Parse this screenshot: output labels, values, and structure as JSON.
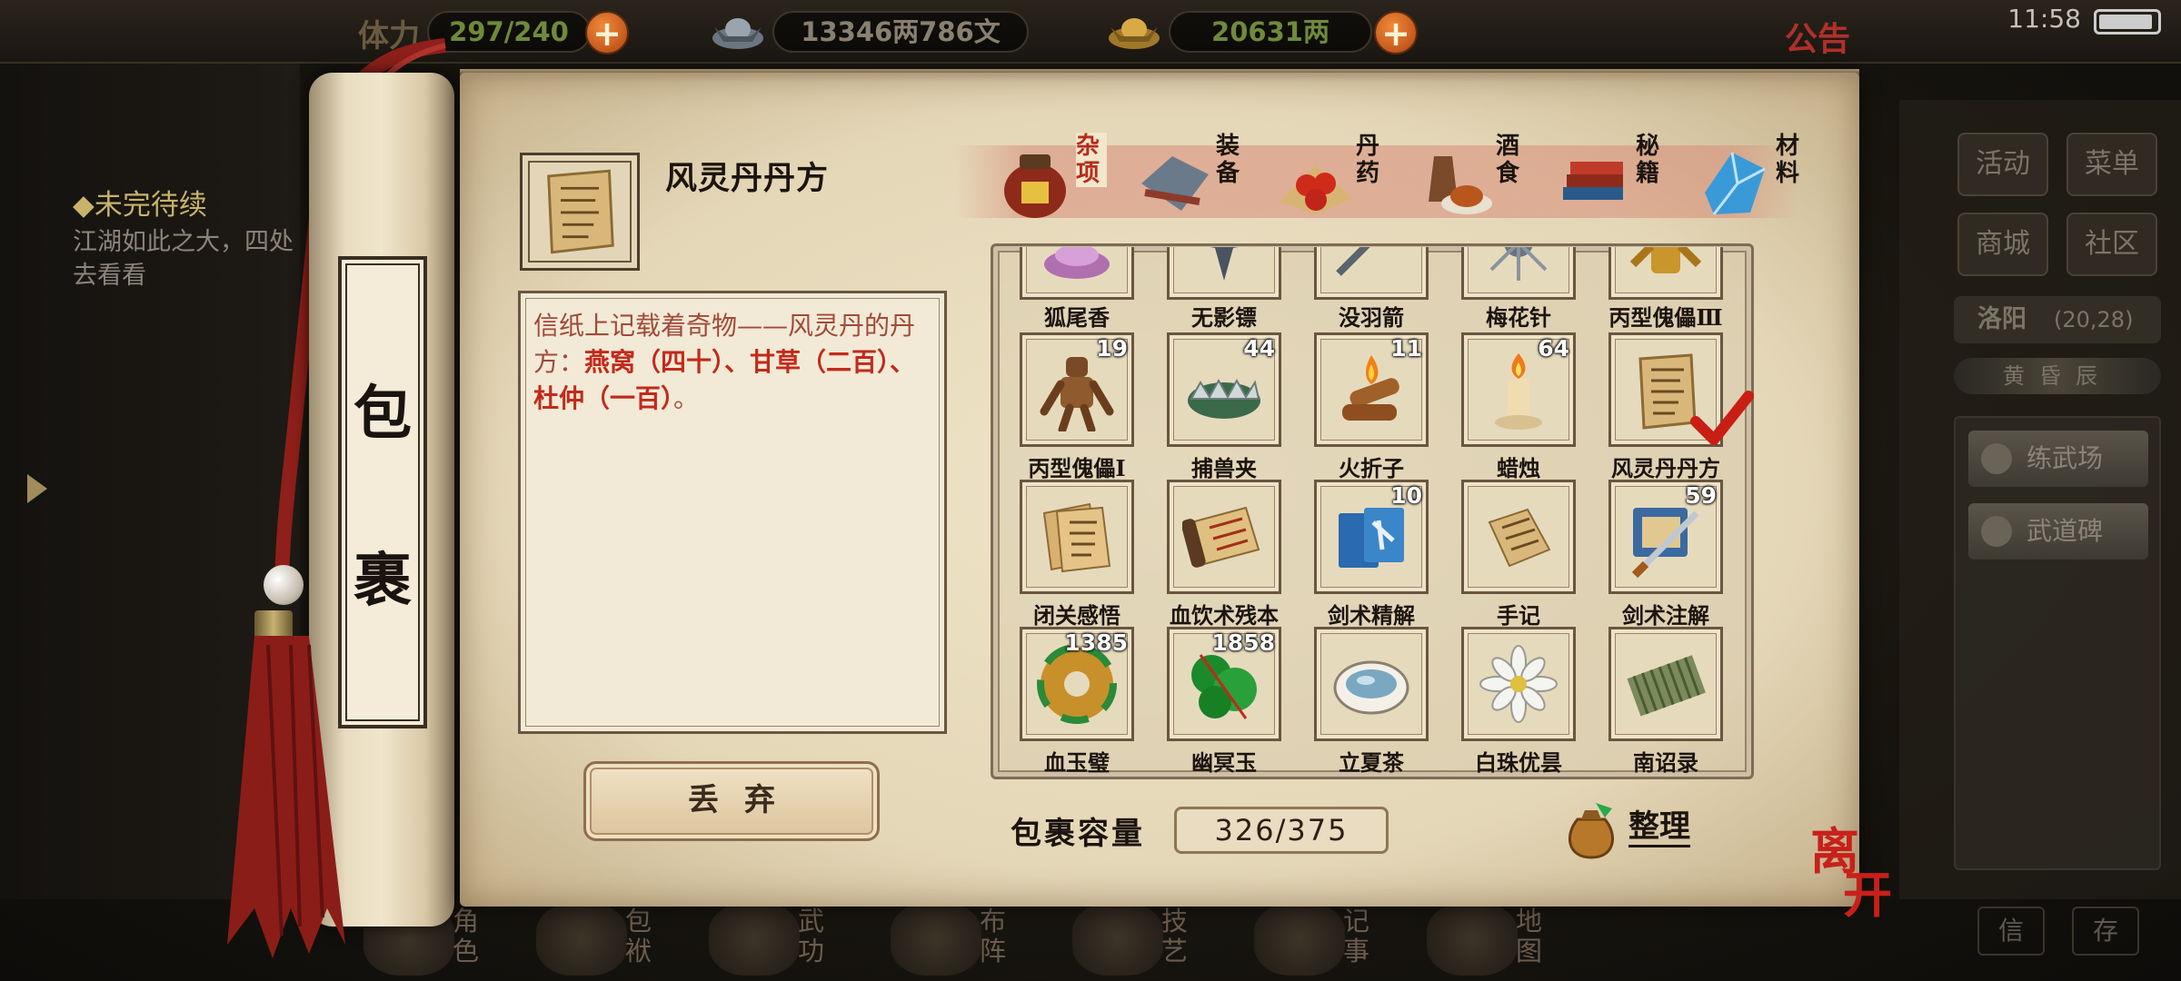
{
  "status_bar": {
    "time": "11:58"
  },
  "top_bar": {
    "stamina_label": "体力",
    "stamina": "297/240",
    "silver": "13346两786文",
    "gold": "20631两",
    "notice": "公告"
  },
  "quest": {
    "title": "◆未完待续",
    "text": "江湖如此之大，四处去看看"
  },
  "right_panel": {
    "buttons": [
      "活动",
      "菜单",
      "商城",
      "社区"
    ],
    "location": "洛阳",
    "coords": "(20,28)",
    "time_of_day": "黄昏辰",
    "places": [
      "练武场",
      "武道碑"
    ],
    "mini_buttons": [
      "信",
      "存"
    ]
  },
  "bottom_nav": [
    "角色",
    "包袱",
    "武功",
    "布阵",
    "技艺",
    "记事",
    "地图"
  ],
  "scroll_label": [
    "包",
    "裹"
  ],
  "item": {
    "name": "风灵丹丹方",
    "desc_prefix": "信纸上记载着奇物——风灵丹的丹方：",
    "desc_red": "燕窝（四十）、甘草（二百）、杜仲（一百）",
    "desc_suffix": "。"
  },
  "discard_label": "丢弃",
  "tabs": [
    "杂项",
    "装备",
    "丹药",
    "酒食",
    "秘籍",
    "材料"
  ],
  "active_tab": "杂项",
  "grid": {
    "partial_row": [
      "狐尾香",
      "无影镖",
      "没羽箭",
      "梅花针",
      "丙型傀儡Ⅲ"
    ],
    "rows": [
      [
        {
          "name": "丙型傀儡Ⅰ",
          "count": "19",
          "icon": "puppet-icon"
        },
        {
          "name": "捕兽夹",
          "count": "44",
          "icon": "trap-icon"
        },
        {
          "name": "火折子",
          "count": "11",
          "icon": "tinder-icon"
        },
        {
          "name": "蜡烛",
          "count": "64",
          "icon": "candle-icon"
        },
        {
          "name": "风灵丹丹方",
          "count": "",
          "icon": "recipe-icon",
          "selected": true
        }
      ],
      [
        {
          "name": "闭关感悟",
          "count": "",
          "icon": "notes-icon"
        },
        {
          "name": "血饮术残本",
          "count": "",
          "icon": "scroll-icon"
        },
        {
          "name": "剑术精解",
          "count": "10",
          "icon": "book-icon"
        },
        {
          "name": "手记",
          "count": "",
          "icon": "letter-icon"
        },
        {
          "name": "剑术注解",
          "count": "59",
          "icon": "sword-scroll-icon"
        }
      ],
      [
        {
          "name": "血玉璧",
          "count": "1385",
          "icon": "jade-disc-icon"
        },
        {
          "name": "幽冥玉",
          "count": "1858",
          "icon": "green-jade-icon"
        },
        {
          "name": "立夏茶",
          "count": "",
          "icon": "tea-icon"
        },
        {
          "name": "白珠优昙",
          "count": "",
          "icon": "flower-icon"
        },
        {
          "name": "南诏录",
          "count": "",
          "icon": "bamboo-scroll-icon"
        }
      ]
    ]
  },
  "capacity": {
    "label": "包裹容量",
    "value": "326/375"
  },
  "sort_label": "整理",
  "leave_label": "离开",
  "colors": {
    "accent_red": "#c22a1c",
    "paper": "#efe4c9",
    "plus_orange": "#e0661f"
  }
}
